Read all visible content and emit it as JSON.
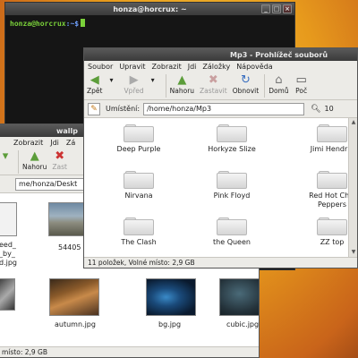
{
  "terminal": {
    "title": "honza@horcrux: ~",
    "prompt_user": "honza@horcrux",
    "prompt_path": ":~$"
  },
  "mp3_window": {
    "title": "Mp3 - Prohlížeč souborů",
    "menu": [
      "Soubor",
      "Upravit",
      "Zobrazit",
      "Jdi",
      "Záložky",
      "Nápověda"
    ],
    "toolbar": {
      "back": "Zpět",
      "forward": "Vpřed",
      "up": "Nahoru",
      "stop": "Zastavit",
      "reload": "Obnovit",
      "home": "Domů",
      "computer": "Poč"
    },
    "location_label": "Umístění:",
    "location_value": "/home/honza/Mp3",
    "zoom_value": "10",
    "folders": [
      "Deep Purple",
      "Horkyze Slize",
      "Jimi Hendrix",
      "Nirvana",
      "Pink Floyd",
      "Red Hot Chili Peppers",
      "The Clash",
      "the Queen",
      "ZZ top"
    ],
    "status": "11 položek, Volné místo: 2,9 GB"
  },
  "wallp_window": {
    "title": "wallp",
    "menu": [
      "Zobrazit",
      "Jdi",
      "Zá"
    ],
    "toolbar": {
      "up": "Nahoru",
      "stop": "Zast"
    },
    "location_value": "me/honza/Deskt",
    "files_partial": [
      "eed_\n_by_\nd.jpg",
      "54405"
    ],
    "files": [
      "autumn.jpg",
      "bg.jpg",
      "cubic.jpg"
    ],
    "status": "é místo: 2,9 GB"
  },
  "colors": {
    "desktop": "#e79a1c",
    "titlebar": "#3a3a3a",
    "terminal_bg": "#151515",
    "prompt_user": "#7ad13a",
    "prompt_path": "#6fa0ff"
  }
}
